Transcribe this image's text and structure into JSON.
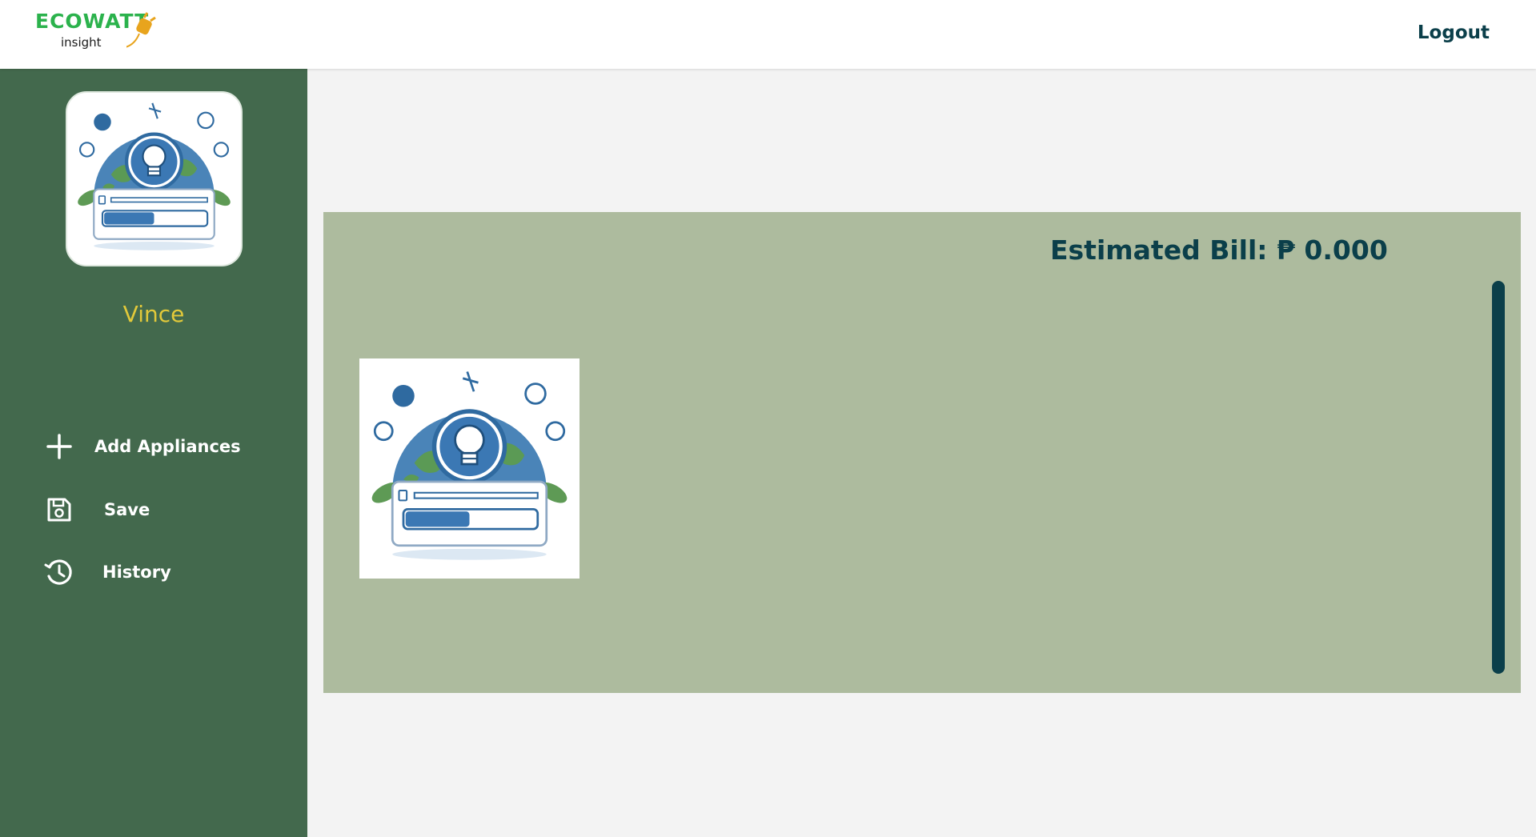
{
  "header": {
    "logo_text": "ECOWATT",
    "logo_subtext": "insight",
    "logout_label": "Logout"
  },
  "sidebar": {
    "username": "Vince",
    "items": [
      {
        "label": "Add Appliances",
        "icon": "plus-icon"
      },
      {
        "label": "Save",
        "icon": "floppy-disk-icon"
      },
      {
        "label": "History",
        "icon": "history-icon"
      }
    ]
  },
  "main": {
    "bill_text": "Estimated Bill: ₱ 0.000"
  },
  "colors": {
    "sidebar": "#43694d",
    "panel": "#adbb9e",
    "accent_dark": "#0b3f4a",
    "username": "#e2c93a",
    "logo_green": "#2bb24c"
  }
}
